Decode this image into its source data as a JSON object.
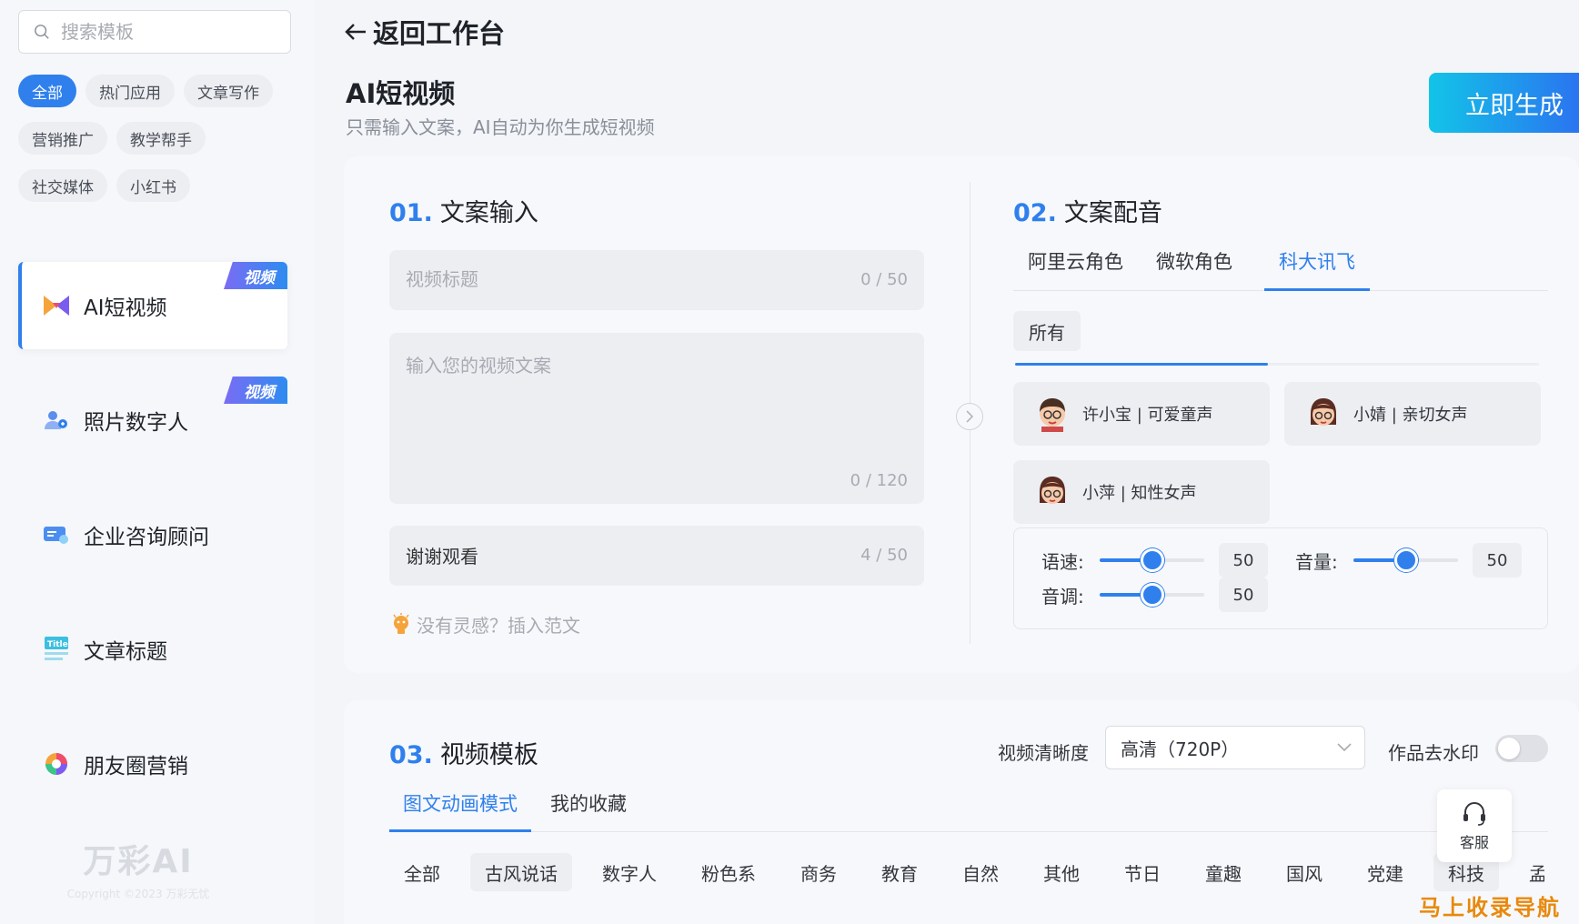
{
  "search": {
    "placeholder": "搜索模板"
  },
  "categories": [
    {
      "label": "全部",
      "active": true
    },
    {
      "label": "热门应用"
    },
    {
      "label": "文章写作"
    },
    {
      "label": "营销推广"
    },
    {
      "label": "教学帮手"
    },
    {
      "label": "社交媒体"
    },
    {
      "label": "小红书"
    }
  ],
  "apps": [
    {
      "label": "AI短视频",
      "tag": "视频",
      "icon": "bowtie-video-icon"
    },
    {
      "label": "照片数字人",
      "tag": "视频",
      "icon": "digital-person-icon"
    },
    {
      "label": "企业咨询顾问",
      "icon": "consultant-card-icon"
    },
    {
      "label": "文章标题",
      "icon": "title-doc-icon"
    },
    {
      "label": "朋友圈营销",
      "icon": "color-wheel-icon"
    }
  ],
  "brand": {
    "logo": "万彩AI",
    "copyright": "Copyright ©2023 万彩无忧"
  },
  "header": {
    "back": "返回工作台",
    "title": "AI短视频",
    "subtitle": "只需输入文案，AI自动为你生成短视频",
    "generate": "立即生成"
  },
  "section1": {
    "num": "01.",
    "title": "文案输入",
    "title_field": {
      "placeholder": "视频标题",
      "count": "0 / 50"
    },
    "script_field": {
      "placeholder": "输入您的视频文案",
      "count": "0 / 120"
    },
    "ending_field": {
      "value": "谢谢观看",
      "count": "4 / 50"
    },
    "tip": "没有灵感？插入范文"
  },
  "section2": {
    "num": "02.",
    "title": "文案配音",
    "tabs": [
      {
        "label": "阿里云角色"
      },
      {
        "label": "微软角色"
      },
      {
        "label": "科大讯飞",
        "active": true
      }
    ],
    "filter": "所有",
    "voices": [
      {
        "name": "许小宝 | 可爱童声"
      },
      {
        "name": "小婧 | 亲切女声"
      },
      {
        "name": "小萍 | 知性女声"
      }
    ],
    "speed": {
      "label": "语速:",
      "value": "50"
    },
    "volume": {
      "label": "音量:",
      "value": "50"
    },
    "pitch": {
      "label": "音调:",
      "value": "50"
    }
  },
  "section3": {
    "num": "03.",
    "title": "视频模板",
    "quality_label": "视频清晰度",
    "quality_value": "高清（720P）",
    "watermark_label": "作品去水印",
    "watermark_on": false,
    "tabs": [
      {
        "label": "图文动画模式",
        "active": true
      },
      {
        "label": "我的收藏"
      }
    ],
    "template_cats": [
      "全部",
      "古风说话",
      "数字人",
      "粉色系",
      "商务",
      "教育",
      "自然",
      "其他",
      "节日",
      "童趣",
      "国风",
      "党建",
      "科技",
      "孟"
    ]
  },
  "support": {
    "label": "客服"
  },
  "watermark_text": "马上收录导航",
  "colors": {
    "accent": "#2f80ed",
    "generate_from": "#12c4e8",
    "generate_to": "#2b72f0"
  }
}
